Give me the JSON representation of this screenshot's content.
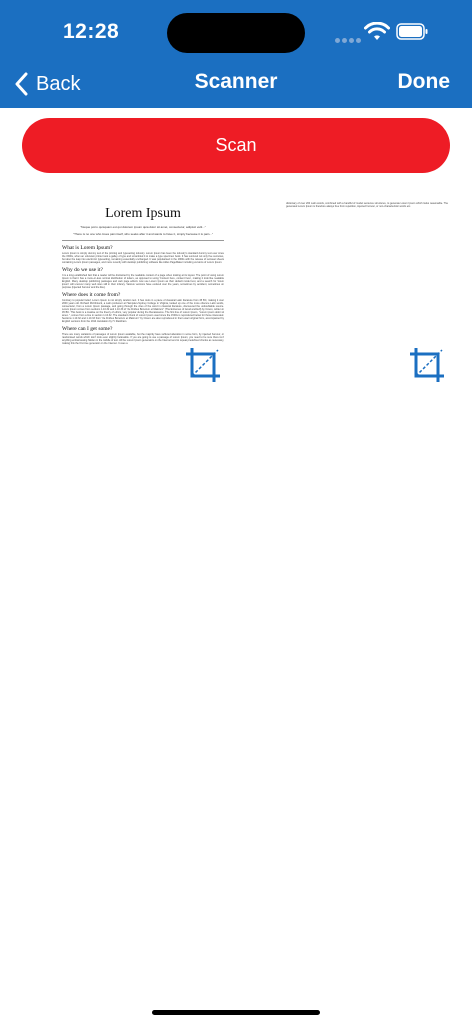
{
  "status_bar": {
    "time": "12:28"
  },
  "nav": {
    "back_label": "Back",
    "title": "Scanner",
    "done_label": "Done"
  },
  "actions": {
    "scan_label": "Scan"
  },
  "documents": [
    {
      "title": "Lorem Ipsum",
      "quote": "\"Neque porro quisquam est qui dolorem ipsum quia dolor sit amet, consectetur, adipisci velit...\"",
      "subquote": "\"There is no one who loves pain itself, who seeks after it and wants to have it, simply because it is pain...\"",
      "sections": [
        {
          "heading": "What is Lorem Ipsum?",
          "body": "Lorem Ipsum is simply dummy text of the printing and typesetting industry. Lorem Ipsum has been the industry's standard dummy text ever since the 1500s, when an unknown printer took a galley of type and scrambled it to make a type specimen book. It has survived not only five centuries, but also the leap into electronic typesetting, remaining essentially unchanged. It was popularised in the 1960s with the release of Letraset sheets containing Lorem Ipsum passages, and more recently with desktop publishing software like Aldus PageMaker including versions of Lorem Ipsum."
        },
        {
          "heading": "Why do we use it?",
          "body": "It is a long established fact that a reader will be distracted by the readable content of a page when looking at its layout. The point of using Lorem Ipsum is that it has a more-or-less normal distribution of letters, as opposed to using 'Content here, content here', making it look like readable English. Many desktop publishing packages and web page editors now use Lorem Ipsum as their default model text, and a search for 'lorem ipsum' will uncover many web sites still in their infancy. Various versions have evolved over the years, sometimes by accident, sometimes on purpose (injected humour and the like)."
        },
        {
          "heading": "Where does it come from?",
          "body": "Contrary to popular belief, Lorem Ipsum is not simply random text. It has roots in a piece of classical Latin literature from 45 BC, making it over 2000 years old. Richard McClintock, a Latin professor at Hampden-Sydney College in Virginia, looked up one of the more obscure Latin words, consectetur, from a Lorem Ipsum passage, and going through the cites of the word in classical literature, discovered the undoubtable source. Lorem Ipsum comes from sections 1.10.32 and 1.10.33 of \"de Finibus Bonorum et Malorum\" (The Extremes of Good and Evil) by Cicero, written in 45 BC. This book is a treatise on the theory of ethics, very popular during the Renaissance. The first line of Lorem Ipsum, \"Lorem ipsum dolor sit amet..\", comes from a line in section 1.10.32. The standard chunk of Lorem Ipsum used since the 1500s is reproduced below for those interested. Sections 1.10.32 and 1.10.33 from \"de Finibus Bonorum et Malorum\" by Cicero are also reproduced in their exact original form, accompanied by English versions from the 1914 translation by H. Rackham."
        },
        {
          "heading": "Where can I get some?",
          "body": "There are many variations of passages of Lorem Ipsum available, but the majority have suffered alteration in some form, by injected humour, or randomised words which don't look even slightly believable. If you are going to use a passage of Lorem Ipsum, you need to be sure there isn't anything embarrassing hidden in the middle of text. All the Lorem Ipsum generators on the Internet tend to repeat predefined chunks as necessary, making this the first true generator on the Internet. It uses a"
        }
      ]
    },
    {
      "body": "dictionary of over 200 Latin words, combined with a handful of model sentence structures, to generate Lorem Ipsum which looks reasonable. The generated Lorem Ipsum is therefore always free from repetition, injected humour, or non-characteristic words etc."
    }
  ],
  "icons": {
    "crop": "crop-icon",
    "back": "chevron-left-icon"
  },
  "colors": {
    "header": "#1b6fc1",
    "scan_button": "#ee1c25",
    "crop_icon": "#1b6fc1"
  }
}
